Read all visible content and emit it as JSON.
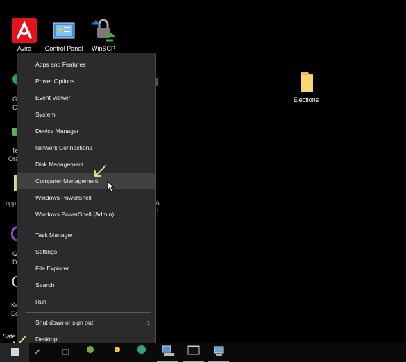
{
  "desktop": {
    "icons": [
      {
        "name": "avira-icon",
        "label": "Avira"
      },
      {
        "name": "control-panel-icon",
        "label": "Control Panel"
      },
      {
        "name": "winscp-icon",
        "label": "WinSCP"
      },
      {
        "name": "elections-folder-icon",
        "label": "Elections"
      }
    ],
    "partial_labels": {
      "l1": "G",
      "l2": "C",
      "l3": "Te",
      "l4": "Ora",
      "l5": "npp",
      "l6": "G",
      "l7": "D",
      "l8": "Ke",
      "l9": "Ec",
      "safe": "Safe",
      "right_fragment": "A...",
      "right_t": "t"
    }
  },
  "context_menu": {
    "group1": [
      "Apps and Features",
      "Power Options",
      "Event Viewer",
      "System",
      "Device Manager",
      "Network Connections",
      "Disk Management",
      "Computer Management",
      "Windows PowerShell",
      "Windows PowerShell (Admin)"
    ],
    "group2": [
      "Task Manager",
      "Settings",
      "File Explorer",
      "Search",
      "Run"
    ],
    "group3": [
      "Shut down or sign out",
      "Desktop"
    ],
    "highlighted": "Computer Management"
  },
  "annotations": {
    "arrow_color": "#e8f08a"
  }
}
